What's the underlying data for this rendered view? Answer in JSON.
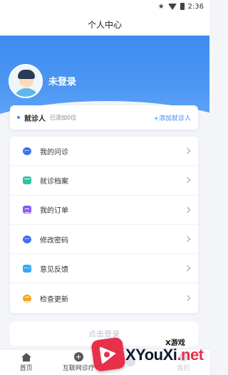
{
  "status_bar": {
    "time": "2:36"
  },
  "header": {
    "title": "个人中心"
  },
  "profile": {
    "login_status": "未登录"
  },
  "patient_card": {
    "label": "就诊人",
    "count_text": "已添加0位",
    "add_label": "+添加就诊人"
  },
  "menu": {
    "items": [
      {
        "label": "我的问诊",
        "icon": "chat-bubble-icon",
        "color": "#3f6ff0"
      },
      {
        "label": "就诊档案",
        "icon": "archive-icon",
        "color": "#30c2a0"
      },
      {
        "label": "我的订单",
        "icon": "order-icon",
        "color": "#8b5cf6"
      },
      {
        "label": "修改密码",
        "icon": "password-icon",
        "color": "#3f6ff0"
      },
      {
        "label": "意见反馈",
        "icon": "feedback-icon",
        "color": "#3aa7f0"
      },
      {
        "label": "检查更新",
        "icon": "update-icon",
        "color": "#f5a623"
      }
    ]
  },
  "logout": {
    "label": "点击登录"
  },
  "bottom_nav": {
    "items": [
      {
        "label": "首页",
        "icon": "home-icon"
      },
      {
        "label": "互联网诊疗",
        "icon": "plus-circle-icon"
      },
      {
        "label": "",
        "icon": "message-icon"
      },
      {
        "label": "我的",
        "icon": "user-icon"
      }
    ]
  },
  "watermark": {
    "badge": "X游戏",
    "text_main": "XYouXi",
    "text_suffix": ".net"
  },
  "colors": {
    "primary": "#3d8bf0",
    "background": "#f3f5f9"
  }
}
